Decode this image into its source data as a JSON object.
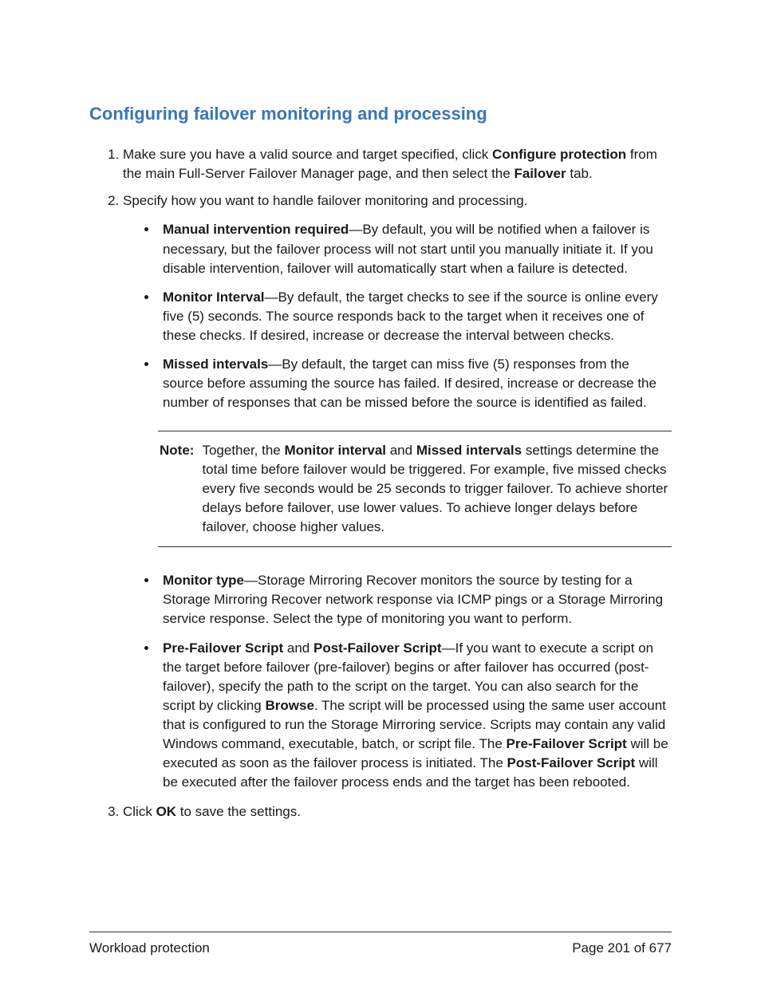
{
  "heading": "Configuring failover monitoring and processing",
  "steps": {
    "s1": {
      "pre": "Make sure you have a valid source and target specified, click ",
      "b1": "Configure protection",
      "mid": " from the main Full-Server Failover Manager page, and then select the ",
      "b2": "Failover",
      "post": " tab."
    },
    "s2": {
      "intro": "Specify how you want to handle failover monitoring and processing.",
      "items": {
        "i1": {
          "b": "Manual intervention required",
          "rest": "—By default, you will be notified when a failover is necessary, but the failover process will not start until you manually initiate it. If you disable intervention, failover will automatically start when a failure is detected."
        },
        "i2": {
          "b": "Monitor Interval",
          "rest": "—By default, the target checks to see if the source is online every five (5) seconds. The source responds back to the target when it receives one of these checks. If desired, increase or decrease the interval between checks."
        },
        "i3": {
          "b": "Missed intervals",
          "rest": "—By default, the target can miss five (5) responses from the source before assuming the source has failed. If desired, increase or decrease the number of responses that can be missed before the source is identified as failed."
        },
        "i4": {
          "b": "Monitor type",
          "rest": "—Storage Mirroring Recover monitors the source by testing for a Storage Mirroring Recover network response via ICMP pings or a Storage Mirroring service response. Select the type of monitoring you want to perform."
        },
        "i5": {
          "b1": "Pre-Failover Script",
          "mid1": " and ",
          "b2": "Post-Failover Script",
          "t1": "—If you want to execute a script on the target before failover (pre-failover) begins or after failover has occurred (post-failover), specify the path to the script on the target. You can also search for the script by clicking ",
          "b3": "Browse",
          "t2": ". The script will be processed using the same user account that is configured to run the Storage Mirroring service. Scripts may contain any valid Windows command, executable, batch, or script file. The ",
          "b4": "Pre-Failover Script",
          "t3": " will be executed as soon as the failover process is initiated. The ",
          "b5": "Post-Failover Script",
          "t4": " will be executed after the failover process ends and the target has been rebooted."
        }
      },
      "note": {
        "label": "Note:",
        "t1": "Together, the ",
        "b1": "Monitor interval",
        "t2": " and ",
        "b2": "Missed intervals",
        "t3": " settings determine the total time before failover would be triggered. For example, five missed checks every five seconds would be 25 seconds to trigger failover. To achieve shorter delays before failover, use lower values. To achieve longer delays before failover, choose higher values."
      }
    },
    "s3": {
      "pre": "Click ",
      "b": "OK",
      "post": " to save the settings."
    }
  },
  "footer": {
    "left": "Workload protection",
    "right": "Page 201 of 677"
  }
}
